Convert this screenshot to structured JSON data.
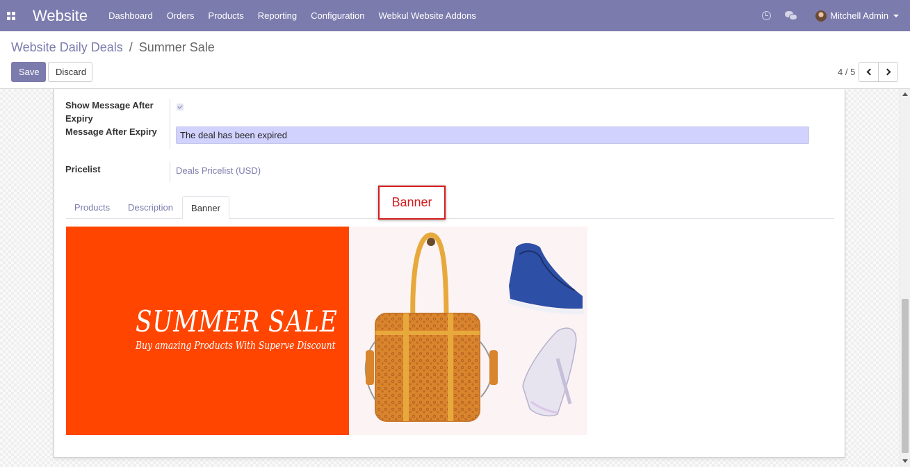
{
  "navbar": {
    "app_name": "Website",
    "menu": [
      "Dashboard",
      "Orders",
      "Products",
      "Reporting",
      "Configuration",
      "Webkul Website Addons"
    ],
    "user_name": "Mitchell Admin",
    "icons": [
      "apps-icon",
      "clock-icon",
      "chat-icon",
      "avatar",
      "caret-down-icon"
    ],
    "brand_color": "#7c7bad"
  },
  "breadcrumb": {
    "parent": "Website Daily Deals",
    "separator": "/",
    "current": "Summer Sale"
  },
  "buttons": {
    "save": "Save",
    "discard": "Discard"
  },
  "pager": {
    "value": "4 / 5"
  },
  "form": {
    "show_message_label": "Show Message After Expiry",
    "show_message_checked": true,
    "message_label": "Message After Expiry",
    "message_value": "The deal has been expired",
    "pricelist_label": "Pricelist",
    "pricelist_value": "Deals Pricelist (USD)"
  },
  "tabs": {
    "items": [
      "Products",
      "Description",
      "Banner"
    ],
    "active": "Banner"
  },
  "callout": {
    "text": "Banner",
    "color": "#d41d1d"
  },
  "banner": {
    "title": "SUMMER SALE",
    "subtitle": "Buy amazing Products With Superve Discount",
    "background_color": "#ff4500",
    "products": [
      "handbag",
      "sneakers",
      "high-heels"
    ]
  }
}
